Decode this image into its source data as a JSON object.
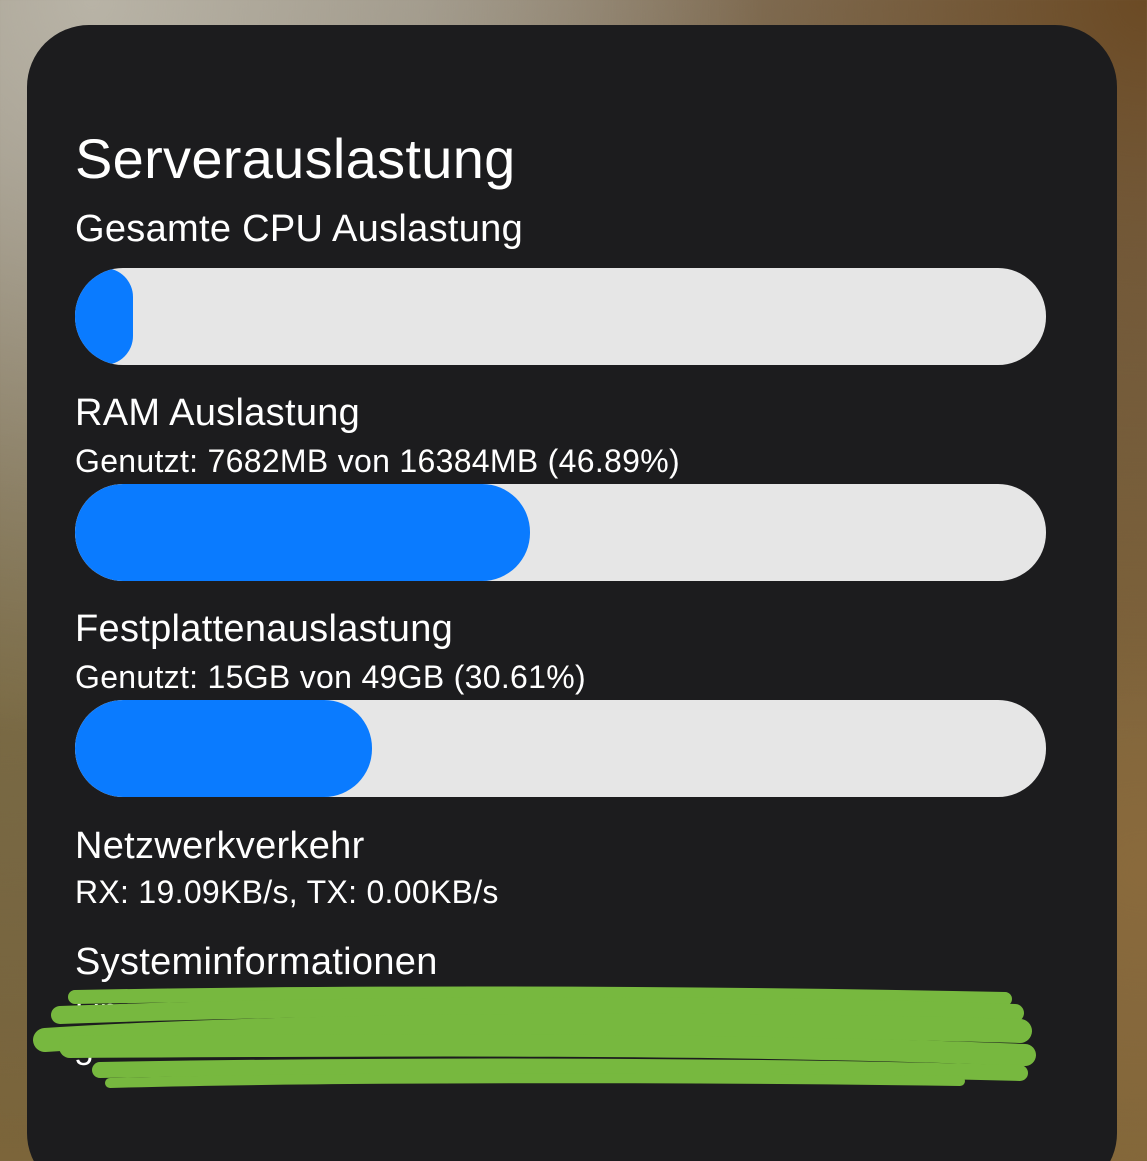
{
  "widget": {
    "title": "Serverauslastung",
    "cpu": {
      "label": "Gesamte CPU Auslastung",
      "usage_fraction": 0.06
    },
    "ram": {
      "label": "RAM Auslastung",
      "detail": "Genutzt: 7682MB von 16384MB (46.89%)",
      "usage_fraction": 0.4689
    },
    "disk": {
      "label": "Festplattenauslastung",
      "detail": "Genutzt: 15GB von 49GB (30.61%)",
      "usage_fraction": 0.3061
    },
    "network": {
      "label": "Netzwerkverkehr",
      "detail": "RX: 19.09KB/s, TX: 0.00KB/s"
    },
    "system": {
      "label": "Systeminformationen",
      "line1": "Linux",
      "line2": "5"
    }
  },
  "colors": {
    "accent": "#0a7bff",
    "track": "#e6e6e6",
    "card": "#1c1c1e",
    "redaction": "#77b83f"
  }
}
